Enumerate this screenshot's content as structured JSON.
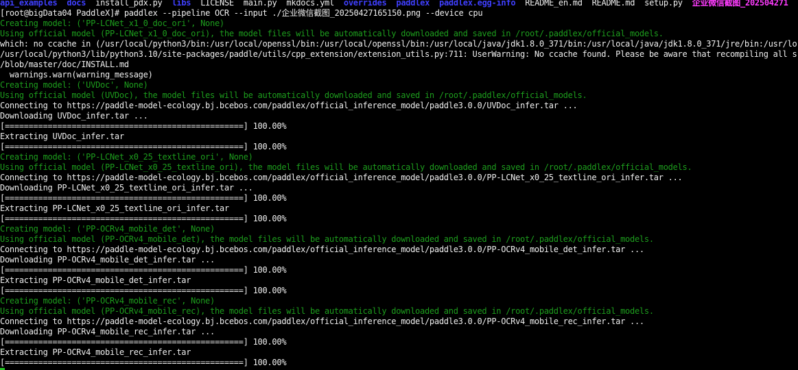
{
  "terminal": {
    "ls_entries": [
      "api_examples",
      "docs",
      "install_pdx.py",
      "libs",
      "LICENSE",
      "main.py",
      "mkdocs.yml",
      "overrides",
      "paddlex",
      "paddlex.egg-info",
      "README_en.md",
      "README.md",
      "setup.py",
      "企业微信截图_202504271"
    ],
    "prompt": "[root@bigData04 PaddleX]#",
    "command": "paddlex --pipeline OCR --input ./企业微信截图_20250427165150.png --device cpu",
    "log": {
      "first_model": {
        "creating": "Creating model: ('PP-LCNet_x1_0_doc_ori', None)",
        "using": "Using official model (PP-LCNet_x1_0_doc_ori), the model files will be automatically downloaded and saved in /root/.paddlex/official_models."
      },
      "ccache_warning": [
        "which: no ccache in (/usr/local/python3/bin:/usr/local/openssl/bin:/usr/local/openssl/bin:/usr/local/java/jdk1.8.0_371/bin:/usr/local/java/jdk1.8.0_371/jre/bin:/usr/lo",
        "/usr/local/python3/lib/python3.10/site-packages/paddle/utils/cpp_extension/extension_utils.py:711: UserWarning: No ccache found. Please be aware that recompiling all s",
        "/blob/master/doc/INSTALL.md",
        "  warnings.warn(warning_message)"
      ],
      "downloads": [
        {
          "creating": "Creating model: ('UVDoc', None)",
          "using": "Using official model (UVDoc), the model files will be automatically downloaded and saved in /root/.paddlex/official_models.",
          "connecting": "Connecting to https://paddle-model-ecology.bj.bcebos.com/paddlex/official_inference_model/paddle3.0.0/UVDoc_infer.tar ...",
          "downloading": "Downloading UVDoc_infer.tar ...",
          "download_progress": "[==================================================] 100.00%",
          "extracting": "Extracting UVDoc_infer.tar",
          "extract_progress": "[==================================================] 100.00%"
        },
        {
          "creating": "Creating model: ('PP-LCNet_x0_25_textline_ori', None)",
          "using": "Using official model (PP-LCNet_x0_25_textline_ori), the model files will be automatically downloaded and saved in /root/.paddlex/official_models.",
          "connecting": "Connecting to https://paddle-model-ecology.bj.bcebos.com/paddlex/official_inference_model/paddle3.0.0/PP-LCNet_x0_25_textline_ori_infer.tar ...",
          "downloading": "Downloading PP-LCNet_x0_25_textline_ori_infer.tar ...",
          "download_progress": "[==================================================] 100.00%",
          "extracting": "Extracting PP-LCNet_x0_25_textline_ori_infer.tar",
          "extract_progress": "[==================================================] 100.00%"
        },
        {
          "creating": "Creating model: ('PP-OCRv4_mobile_det', None)",
          "using": "Using official model (PP-OCRv4_mobile_det), the model files will be automatically downloaded and saved in /root/.paddlex/official_models.",
          "connecting": "Connecting to https://paddle-model-ecology.bj.bcebos.com/paddlex/official_inference_model/paddle3.0.0/PP-OCRv4_mobile_det_infer.tar ...",
          "downloading": "Downloading PP-OCRv4_mobile_det_infer.tar ...",
          "download_progress": "[==================================================] 100.00%",
          "extracting": "Extracting PP-OCRv4_mobile_det_infer.tar",
          "extract_progress": "[==================================================] 100.00%"
        },
        {
          "creating": "Creating model: ('PP-OCRv4_mobile_rec', None)",
          "using": "Using official model (PP-OCRv4_mobile_rec), the model files will be automatically downloaded and saved in /root/.paddlex/official_models.",
          "connecting": "Connecting to https://paddle-model-ecology.bj.bcebos.com/paddlex/official_inference_model/paddle3.0.0/PP-OCRv4_mobile_rec_infer.tar ...",
          "downloading": "Downloading PP-OCRv4_mobile_rec_infer.tar ...",
          "download_progress": "[==================================================] 100.00%",
          "extracting": "Extracting PP-OCRv4_mobile_rec_infer.tar",
          "extract_progress": "[==================================================] 100.00%"
        }
      ]
    }
  },
  "colors": {
    "background": "#000000",
    "foreground": "#f0f0f0",
    "message_green": "#1d9e1d",
    "directory_blue": "#3f3fff",
    "image_magenta": "#ff3cff",
    "cursor_green": "#22c322"
  }
}
